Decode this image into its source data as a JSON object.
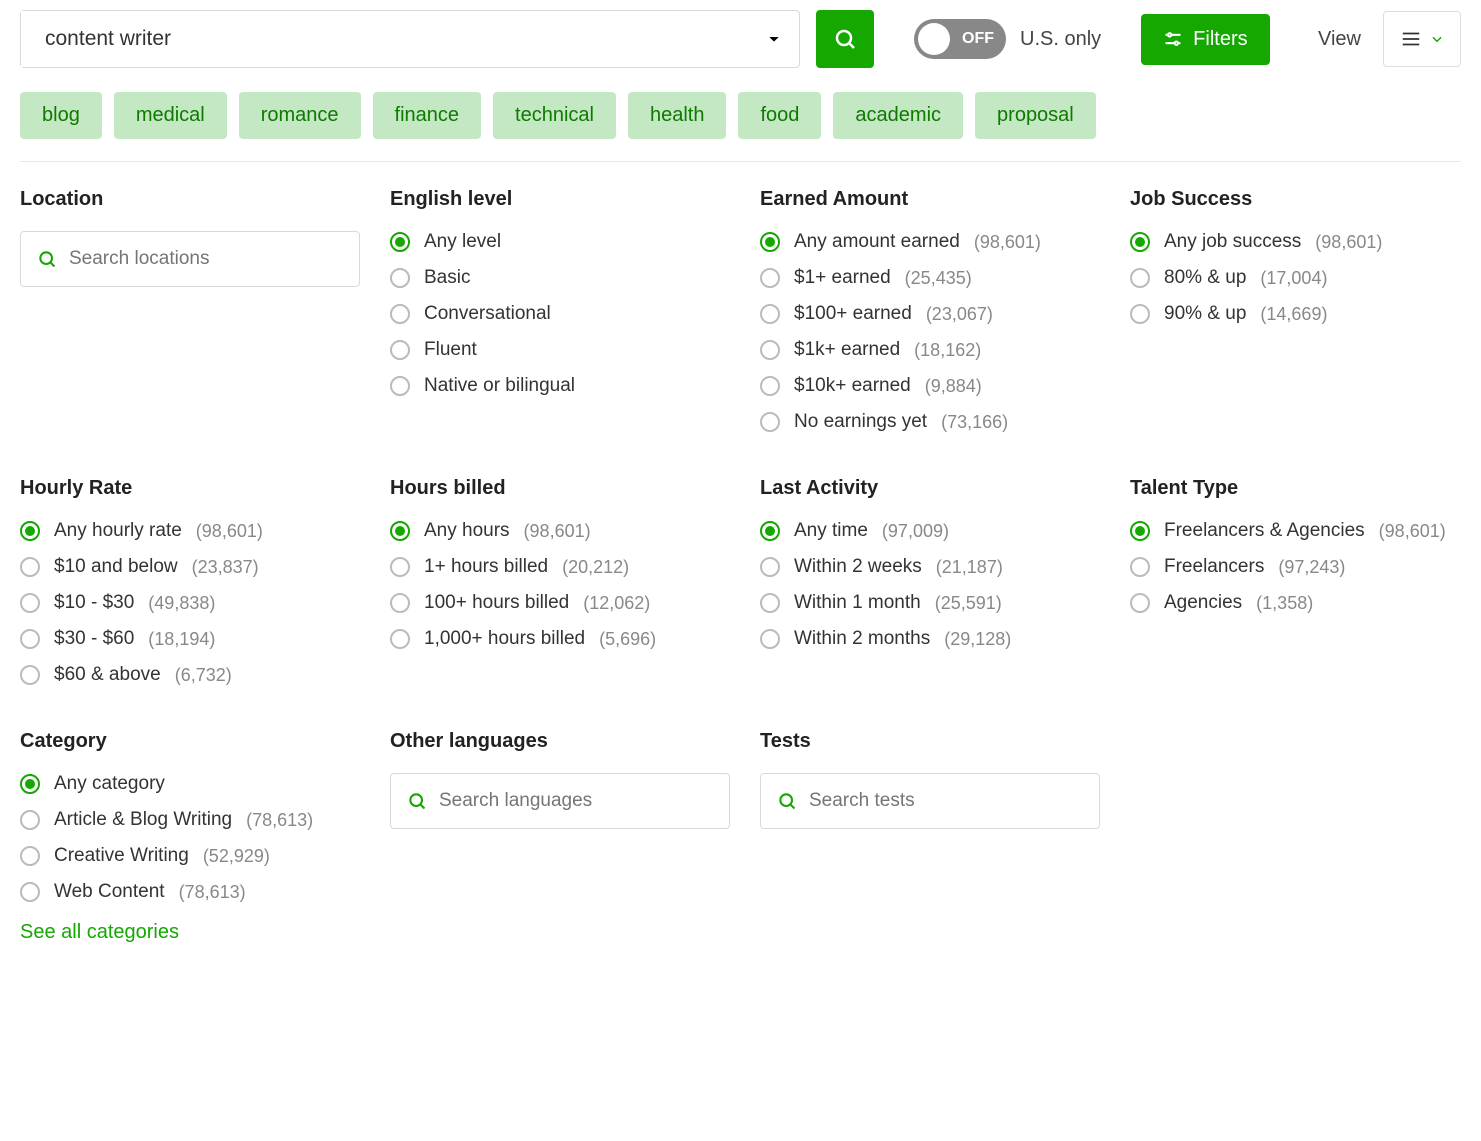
{
  "search": {
    "value": "content writer"
  },
  "toggle": {
    "state": "OFF",
    "label": "U.S. only"
  },
  "filters_button": "Filters",
  "view_label": "View",
  "tags": [
    "blog",
    "medical",
    "romance",
    "finance",
    "technical",
    "health",
    "food",
    "academic",
    "proposal"
  ],
  "groups": {
    "location": {
      "title": "Location",
      "placeholder": "Search locations"
    },
    "english": {
      "title": "English level",
      "options": [
        {
          "label": "Any level",
          "selected": true
        },
        {
          "label": "Basic"
        },
        {
          "label": "Conversational"
        },
        {
          "label": "Fluent"
        },
        {
          "label": "Native or bilingual"
        }
      ]
    },
    "earned": {
      "title": "Earned Amount",
      "options": [
        {
          "label": "Any amount earned",
          "count": "(98,601)",
          "selected": true
        },
        {
          "label": "$1+ earned",
          "count": "(25,435)"
        },
        {
          "label": "$100+ earned",
          "count": "(23,067)"
        },
        {
          "label": "$1k+ earned",
          "count": "(18,162)"
        },
        {
          "label": "$10k+ earned",
          "count": "(9,884)"
        },
        {
          "label": "No earnings yet",
          "count": "(73,166)"
        }
      ]
    },
    "success": {
      "title": "Job Success",
      "options": [
        {
          "label": "Any job success",
          "count": "(98,601)",
          "selected": true
        },
        {
          "label": "80% & up",
          "count": "(17,004)"
        },
        {
          "label": "90% & up",
          "count": "(14,669)"
        }
      ]
    },
    "hourly": {
      "title": "Hourly Rate",
      "options": [
        {
          "label": "Any hourly rate",
          "count": "(98,601)",
          "selected": true
        },
        {
          "label": "$10 and below",
          "count": "(23,837)"
        },
        {
          "label": "$10 - $30",
          "count": "(49,838)"
        },
        {
          "label": "$30 - $60",
          "count": "(18,194)"
        },
        {
          "label": "$60 & above",
          "count": "(6,732)"
        }
      ]
    },
    "hours": {
      "title": "Hours billed",
      "options": [
        {
          "label": "Any hours",
          "count": "(98,601)",
          "selected": true
        },
        {
          "label": "1+ hours billed",
          "count": "(20,212)"
        },
        {
          "label": "100+ hours billed",
          "count": "(12,062)"
        },
        {
          "label": "1,000+ hours billed",
          "count": "(5,696)"
        }
      ]
    },
    "activity": {
      "title": "Last Activity",
      "options": [
        {
          "label": "Any time",
          "count": "(97,009)",
          "selected": true
        },
        {
          "label": "Within 2 weeks",
          "count": "(21,187)"
        },
        {
          "label": "Within 1 month",
          "count": "(25,591)"
        },
        {
          "label": "Within 2 months",
          "count": "(29,128)"
        }
      ]
    },
    "talent": {
      "title": "Talent Type",
      "options": [
        {
          "label": "Freelancers & Agencies",
          "count": "(98,601)",
          "selected": true
        },
        {
          "label": "Freelancers",
          "count": "(97,243)"
        },
        {
          "label": "Agencies",
          "count": "(1,358)"
        }
      ]
    },
    "category": {
      "title": "Category",
      "options": [
        {
          "label": "Any category",
          "selected": true
        },
        {
          "label": "Article & Blog Writing",
          "count": "(78,613)"
        },
        {
          "label": "Creative Writing",
          "count": "(52,929)"
        },
        {
          "label": "Web Content",
          "count": "(78,613)"
        }
      ],
      "more": "See all categories"
    },
    "other_lang": {
      "title": "Other languages",
      "placeholder": "Search languages"
    },
    "tests": {
      "title": "Tests",
      "placeholder": "Search tests"
    }
  }
}
